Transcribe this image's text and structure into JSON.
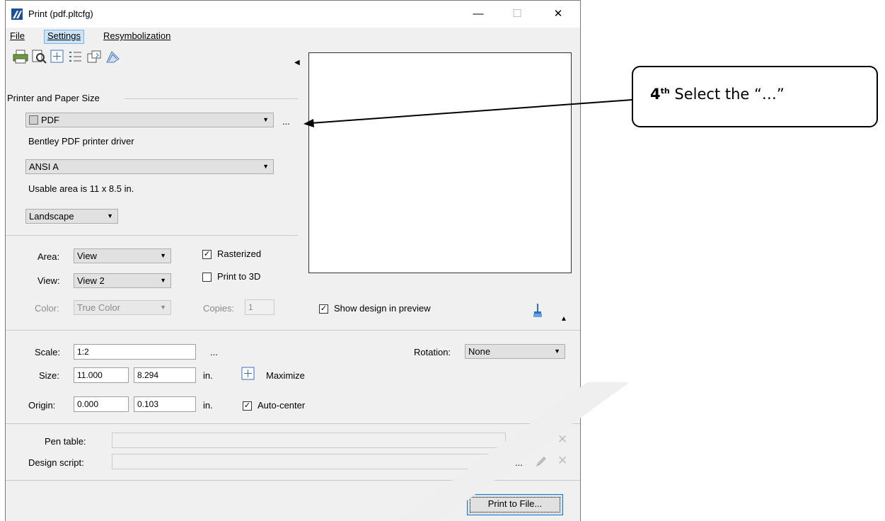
{
  "window": {
    "title": "Print  (pdf.pltcfg)",
    "minimize_glyph": "—",
    "maximize_glyph": "☐",
    "close_glyph": "✕"
  },
  "menu": {
    "file": "File",
    "settings": "Settings",
    "resymbolization": "Resymbolization"
  },
  "toolbar": {
    "icons": [
      "printer-icon",
      "preview-zoom-icon",
      "fit-area-icon",
      "list-icon",
      "page-setup-icon",
      "print-style-icon"
    ],
    "collapse_arrow": "◀"
  },
  "printer_section": {
    "heading": "Printer and Paper Size",
    "printer_value": "PDF",
    "printer_browse": "...",
    "driver_text": "Bentley PDF printer driver",
    "paper_value": "ANSI A",
    "usable_area": "Usable area is 11 x 8.5 in.",
    "orientation_value": "Landscape"
  },
  "area_section": {
    "area_label": "Area:",
    "area_value": "View",
    "view_label": "View:",
    "view_value": "View 2",
    "color_label": "Color:",
    "color_value": "True Color",
    "rasterized_label": "Rasterized",
    "rasterized_checked": "✓",
    "print3d_label": "Print to 3D",
    "copies_label": "Copies:",
    "copies_value": "1",
    "show_design_label": "Show design in preview",
    "show_design_checked": "✓"
  },
  "scale_section": {
    "scale_label": "Scale:",
    "scale_value": "1:2",
    "scale_browse": "...",
    "rotation_label": "Rotation:",
    "rotation_value": "None",
    "size_label": "Size:",
    "size_w": "11.000",
    "size_h": "8.294",
    "size_unit": "in.",
    "maximize_label": "Maximize",
    "origin_label": "Origin:",
    "origin_x": "0.000",
    "origin_y": "0.103",
    "origin_unit": "in.",
    "autocenter_label": "Auto-center",
    "autocenter_checked": "✓"
  },
  "tables_section": {
    "pen_table_label": "Pen table:",
    "design_script_label": "Design script:",
    "browse": "...",
    "clear_glyph": "✕"
  },
  "actions": {
    "print_to_file": "Print to File..."
  },
  "callout": {
    "step_number": "4",
    "step_suffix": "th",
    "text": " Select the “…”"
  },
  "colors": {
    "dialog_bg": "#f0f0f0",
    "accent_blue": "#0078d7",
    "menu_highlight": "#cce4f7"
  }
}
